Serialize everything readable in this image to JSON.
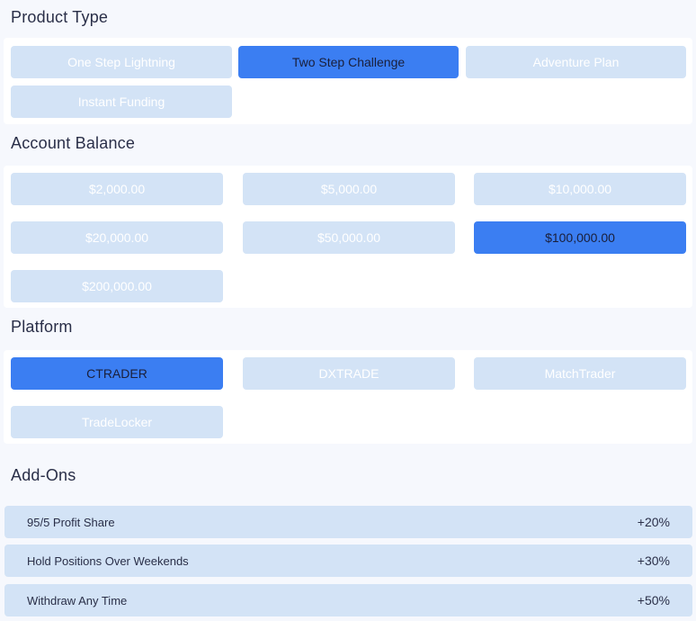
{
  "product_type": {
    "title": "Product Type",
    "options": [
      "One Step Lightning",
      "Two Step Challenge",
      "Adventure Plan",
      "Instant Funding"
    ],
    "selected": "Two Step Challenge"
  },
  "account_balance": {
    "title": "Account Balance",
    "options": [
      "$2,000.00",
      "$5,000.00",
      "$10,000.00",
      "$20,000.00",
      "$50,000.00",
      "$100,000.00",
      "$200,000.00"
    ],
    "selected": "$100,000.00"
  },
  "platform": {
    "title": "Platform",
    "options": [
      "CTRADER",
      "DXTRADE",
      "MatchTrader",
      "TradeLocker"
    ],
    "selected": "CTRADER"
  },
  "addons": {
    "title": "Add-Ons",
    "items": [
      {
        "label": "95/5 Profit Share",
        "price": "+20%"
      },
      {
        "label": "Hold Positions Over Weekends",
        "price": "+30%"
      },
      {
        "label": "Withdraw Any Time",
        "price": "+50%"
      }
    ]
  },
  "colors": {
    "selected": "#3b7ef2",
    "unselected": "#d3e3f6",
    "page_bg": "#f6f8fd"
  }
}
